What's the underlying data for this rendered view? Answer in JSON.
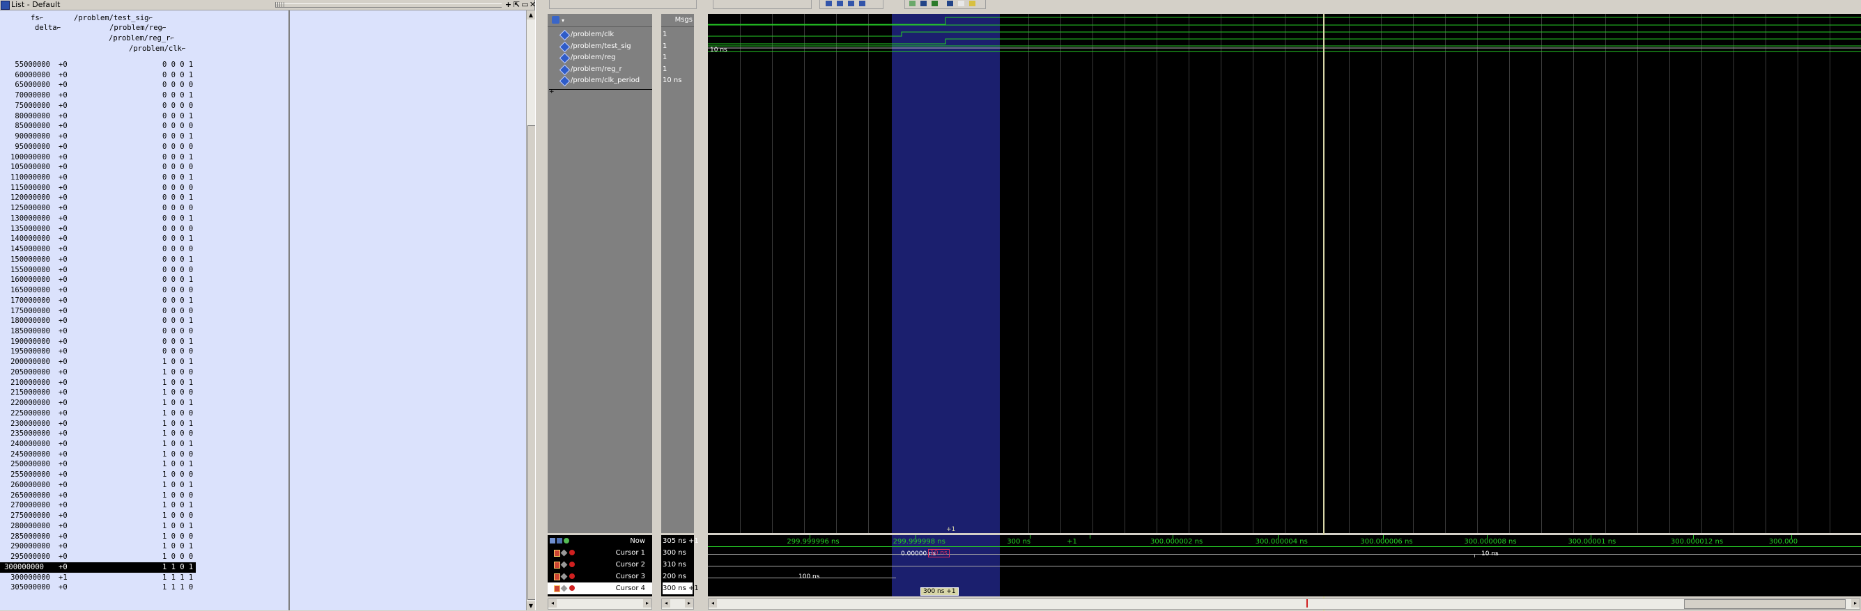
{
  "list_window": {
    "title": "List - Default",
    "headers": [
      "fs",
      "delta",
      "/problem/test_sig",
      "/problem/reg",
      "/problem/reg_r",
      "/problem/clk"
    ],
    "rows": [
      {
        "time": "55000000",
        "delta": "+0",
        "values": "0 0 0 1"
      },
      {
        "time": "60000000",
        "delta": "+0",
        "values": "0 0 0 1"
      },
      {
        "time": "65000000",
        "delta": "+0",
        "values": "0 0 0 0"
      },
      {
        "time": "70000000",
        "delta": "+0",
        "values": "0 0 0 1"
      },
      {
        "time": "75000000",
        "delta": "+0",
        "values": "0 0 0 0"
      },
      {
        "time": "80000000",
        "delta": "+0",
        "values": "0 0 0 1"
      },
      {
        "time": "85000000",
        "delta": "+0",
        "values": "0 0 0 0"
      },
      {
        "time": "90000000",
        "delta": "+0",
        "values": "0 0 0 1"
      },
      {
        "time": "95000000",
        "delta": "+0",
        "values": "0 0 0 0"
      },
      {
        "time": "100000000",
        "delta": "+0",
        "values": "0 0 0 1"
      },
      {
        "time": "105000000",
        "delta": "+0",
        "values": "0 0 0 0"
      },
      {
        "time": "110000000",
        "delta": "+0",
        "values": "0 0 0 1"
      },
      {
        "time": "115000000",
        "delta": "+0",
        "values": "0 0 0 0"
      },
      {
        "time": "120000000",
        "delta": "+0",
        "values": "0 0 0 1"
      },
      {
        "time": "125000000",
        "delta": "+0",
        "values": "0 0 0 0"
      },
      {
        "time": "130000000",
        "delta": "+0",
        "values": "0 0 0 1"
      },
      {
        "time": "135000000",
        "delta": "+0",
        "values": "0 0 0 0"
      },
      {
        "time": "140000000",
        "delta": "+0",
        "values": "0 0 0 1"
      },
      {
        "time": "145000000",
        "delta": "+0",
        "values": "0 0 0 0"
      },
      {
        "time": "150000000",
        "delta": "+0",
        "values": "0 0 0 1"
      },
      {
        "time": "155000000",
        "delta": "+0",
        "values": "0 0 0 0"
      },
      {
        "time": "160000000",
        "delta": "+0",
        "values": "0 0 0 1"
      },
      {
        "time": "165000000",
        "delta": "+0",
        "values": "0 0 0 0"
      },
      {
        "time": "170000000",
        "delta": "+0",
        "values": "0 0 0 1"
      },
      {
        "time": "175000000",
        "delta": "+0",
        "values": "0 0 0 0"
      },
      {
        "time": "180000000",
        "delta": "+0",
        "values": "0 0 0 1"
      },
      {
        "time": "185000000",
        "delta": "+0",
        "values": "0 0 0 0"
      },
      {
        "time": "190000000",
        "delta": "+0",
        "values": "0 0 0 1"
      },
      {
        "time": "195000000",
        "delta": "+0",
        "values": "0 0 0 0"
      },
      {
        "time": "200000000",
        "delta": "+0",
        "values": "1 0 0 1"
      },
      {
        "time": "205000000",
        "delta": "+0",
        "values": "1 0 0 0"
      },
      {
        "time": "210000000",
        "delta": "+0",
        "values": "1 0 0 1"
      },
      {
        "time": "215000000",
        "delta": "+0",
        "values": "1 0 0 0"
      },
      {
        "time": "220000000",
        "delta": "+0",
        "values": "1 0 0 1"
      },
      {
        "time": "225000000",
        "delta": "+0",
        "values": "1 0 0 0"
      },
      {
        "time": "230000000",
        "delta": "+0",
        "values": "1 0 0 1"
      },
      {
        "time": "235000000",
        "delta": "+0",
        "values": "1 0 0 0"
      },
      {
        "time": "240000000",
        "delta": "+0",
        "values": "1 0 0 1"
      },
      {
        "time": "245000000",
        "delta": "+0",
        "values": "1 0 0 0"
      },
      {
        "time": "250000000",
        "delta": "+0",
        "values": "1 0 0 1"
      },
      {
        "time": "255000000",
        "delta": "+0",
        "values": "1 0 0 0"
      },
      {
        "time": "260000000",
        "delta": "+0",
        "values": "1 0 0 1"
      },
      {
        "time": "265000000",
        "delta": "+0",
        "values": "1 0 0 0"
      },
      {
        "time": "270000000",
        "delta": "+0",
        "values": "1 0 0 1"
      },
      {
        "time": "275000000",
        "delta": "+0",
        "values": "1 0 0 0"
      },
      {
        "time": "280000000",
        "delta": "+0",
        "values": "1 0 0 1"
      },
      {
        "time": "285000000",
        "delta": "+0",
        "values": "1 0 0 0"
      },
      {
        "time": "290000000",
        "delta": "+0",
        "values": "1 0 0 1"
      },
      {
        "time": "295000000",
        "delta": "+0",
        "values": "1 0 0 0"
      },
      {
        "time": "300000000",
        "delta": "+0",
        "values": "1 1 0 1",
        "selected": true
      },
      {
        "time": "300000000",
        "delta": "+1",
        "values": "1 1 1 1"
      },
      {
        "time": "305000000",
        "delta": "+0",
        "values": "1 1 1 0"
      }
    ]
  },
  "wave_window": {
    "values_header": "Msgs",
    "signals": [
      {
        "name": "/problem/clk",
        "value": "1"
      },
      {
        "name": "/problem/test_sig",
        "value": "1"
      },
      {
        "name": "/problem/reg",
        "value": "1"
      },
      {
        "name": "/problem/reg_r",
        "value": "1"
      },
      {
        "name": "/problem/clk_period",
        "value": "10 ns"
      }
    ],
    "clk_period_bus_label": "10 ns",
    "selection_top_label": "+1",
    "now": {
      "label": "Now",
      "value": "305 ns +1"
    },
    "cursors": [
      {
        "label": "Cursor 1",
        "value": "300 ns"
      },
      {
        "label": "Cursor 2",
        "value": "310 ns"
      },
      {
        "label": "Cursor 3",
        "value": "200 ns"
      },
      {
        "label": "Cursor 4",
        "value": "300 ns +1"
      }
    ],
    "time_ticks": [
      "299.999996 ns",
      "299.999998 ns",
      "300 ns",
      "+1",
      "300.000002 ns",
      "300.000004 ns",
      "300.000006 ns",
      "300.000008 ns",
      "300.00001 ns",
      "300.000012 ns",
      "300.000"
    ],
    "cursor_annotations": {
      "delta_1": "0.00000 ns",
      "delta_1_box": "10 ns",
      "span_label": "10 ns",
      "cursor3_label": "100 ns",
      "active_cursor_box": "300 ns +1"
    },
    "colors": {
      "wave": "#26d026",
      "selection": "#1b1f6e",
      "cursor": "#d8d6a8",
      "background": "#000000"
    }
  }
}
